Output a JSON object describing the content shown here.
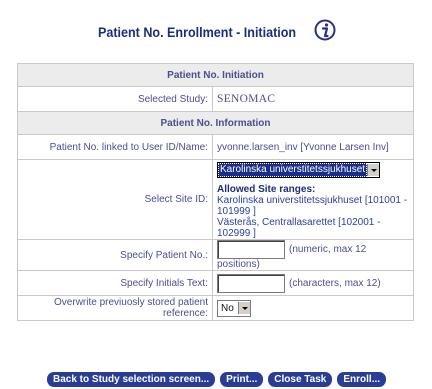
{
  "page": {
    "title": "Patient No. Enrollment - Initiation",
    "info_icon": "info-icon"
  },
  "initiation": {
    "header": "Patient No. Initiation",
    "selected_study_label": "Selected Study:",
    "selected_study_value": "SENOMAC"
  },
  "information": {
    "header": "Patient No. Information",
    "linked_label": "Patient No. linked to User ID/Name:",
    "linked_value": "yvonne.larsen_inv [Yvonne Larsen Inv]",
    "site_label": "Select Site ID:",
    "site_selected": "Karolinska universtitetssjukhuset",
    "allowed_title": "Allowed Site ranges:",
    "ranges": [
      "Karolinska universtitetssjukhuset [101001 - 101999 ]",
      "Västerås, Centrallasarettet [102001 - 102999 ]"
    ],
    "patient_no_label": "Specify Patient No.:",
    "patient_no_value": "",
    "patient_no_hint": "(numeric, max 12 positions)",
    "initials_label": "Specify Initials Text:",
    "initials_value": "",
    "initials_hint": "(characters, max 12)",
    "overwrite_label": "Overwrite previuosly stored patient reference:",
    "overwrite_value": "No"
  },
  "buttons": {
    "back": "Back to Study selection screen...",
    "print": "Print...",
    "close": "Close Task",
    "enroll": "Enroll..."
  },
  "colors": {
    "title": "#1a2f7a",
    "button_bg": "#2a3d96",
    "header_bg": "#ececec",
    "label_text": "#4a4f8f"
  }
}
